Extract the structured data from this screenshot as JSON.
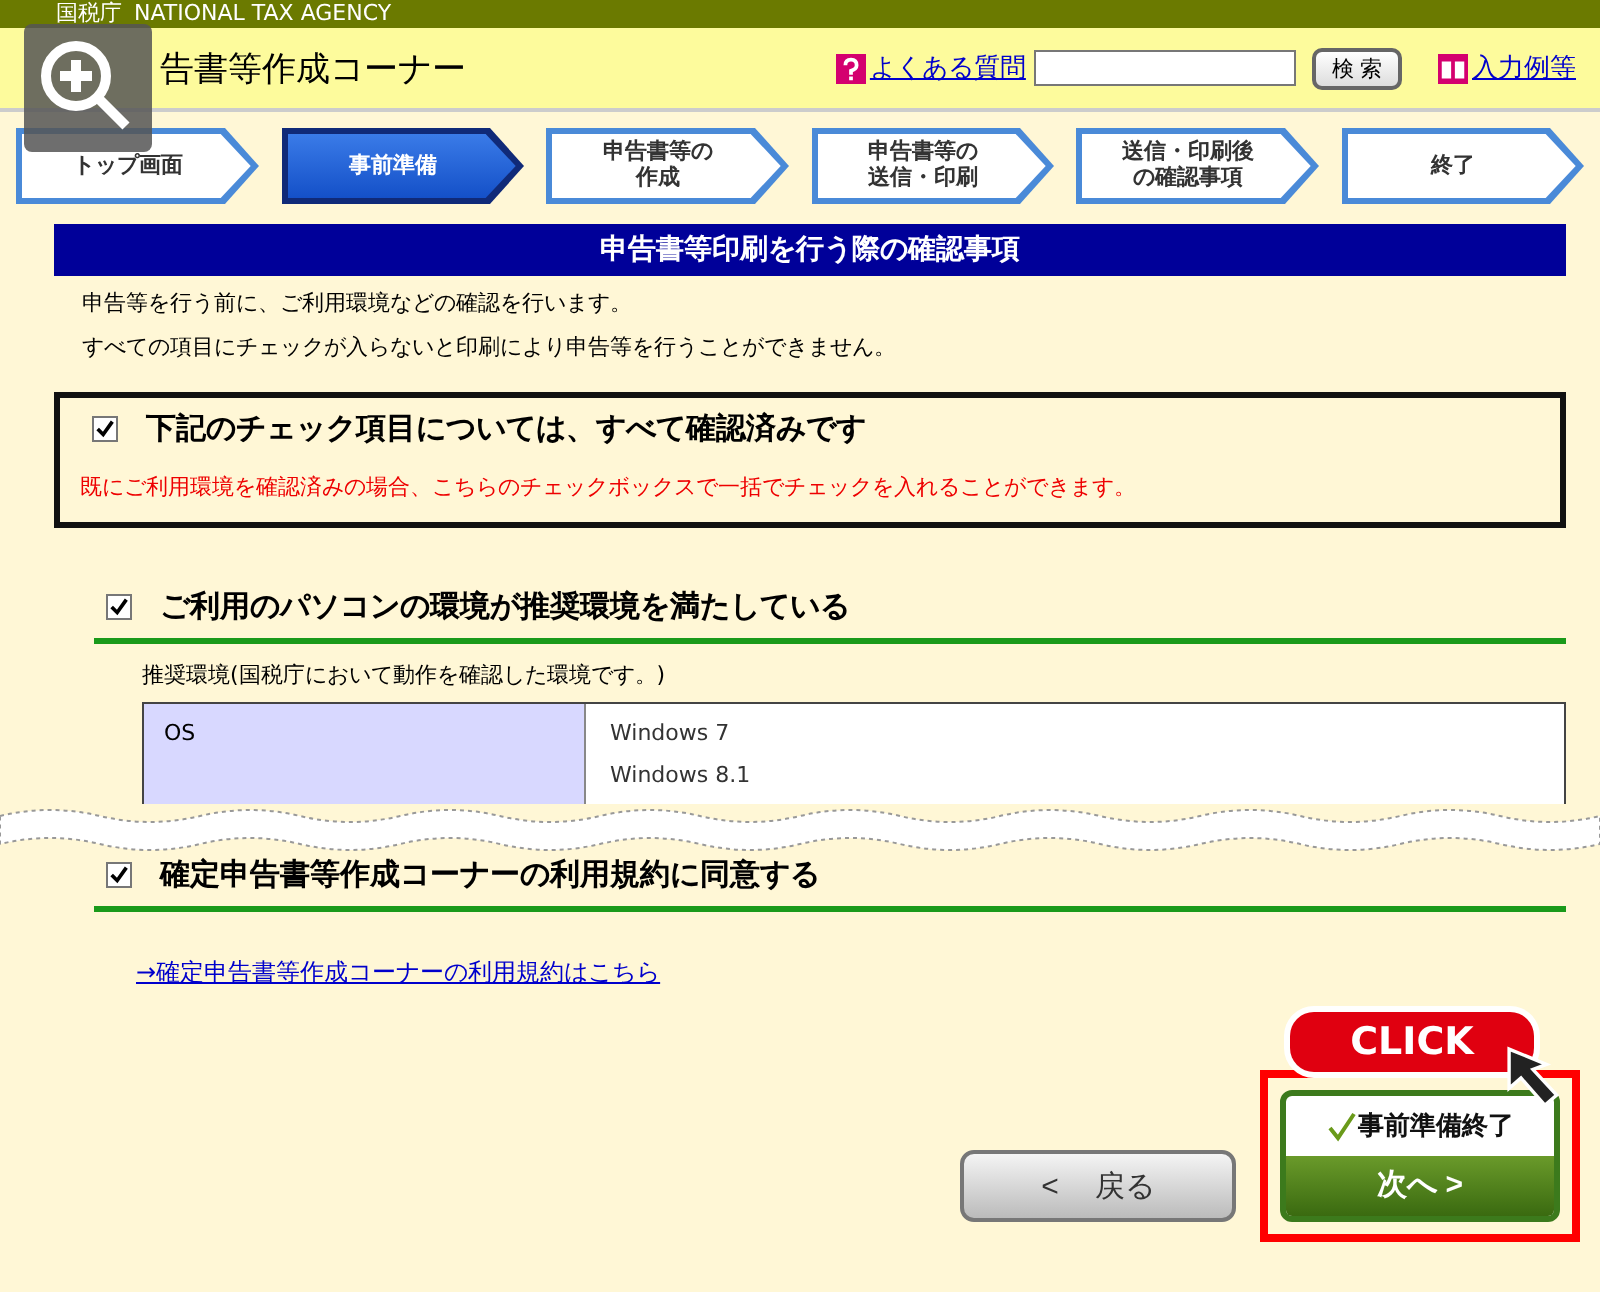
{
  "agency_bar": {
    "kanji": "国税庁",
    "english": "NATIONAL TAX AGENCY"
  },
  "header": {
    "title": "告書等作成コーナー",
    "faq_link": "よくある質問",
    "search_button": "検 索",
    "examples_link": "入力例等"
  },
  "steps": [
    {
      "lines": [
        "トップ画面"
      ],
      "selected": false
    },
    {
      "lines": [
        "事前準備"
      ],
      "selected": true
    },
    {
      "lines": [
        "申告書等の",
        "作成"
      ],
      "selected": false
    },
    {
      "lines": [
        "申告書等の",
        "送信・印刷"
      ],
      "selected": false
    },
    {
      "lines": [
        "送信・印刷後",
        "の確認事項"
      ],
      "selected": false
    },
    {
      "lines": [
        "終了"
      ],
      "selected": false
    }
  ],
  "section_title": "申告書等印刷を行う際の確認事項",
  "intro": [
    "申告等を行う前に、ご利用環境などの確認を行います。",
    "すべての項目にチェックが入らないと印刷により申告等を行うことができません。"
  ],
  "confirm_all": {
    "label": "下記のチェック項目については、すべて確認済みです",
    "checked": true,
    "note": "既にご利用環境を確認済みの場合、こちらのチェックボックスで一括でチェックを入れることができます。"
  },
  "checks": [
    {
      "label": "ご利用のパソコンの環境が推奨環境を満たしている",
      "checked": true
    },
    {
      "label": "確定申告書等作成コーナーの利用規約に同意する",
      "checked": true
    }
  ],
  "environment": {
    "caption": "推奨環境(国税庁において動作を確認した環境です。)",
    "rows": [
      {
        "name": "OS",
        "values": [
          "Windows 7",
          "Windows 8.1"
        ]
      }
    ]
  },
  "terms_link": "→確定申告書等作成コーナーの利用規約はこちら",
  "click_badge": "CLICK",
  "back_button": {
    "arrow": "<",
    "label": "戻る"
  },
  "next_button": {
    "top": "事前準備終了",
    "bottom": "次へ >"
  }
}
